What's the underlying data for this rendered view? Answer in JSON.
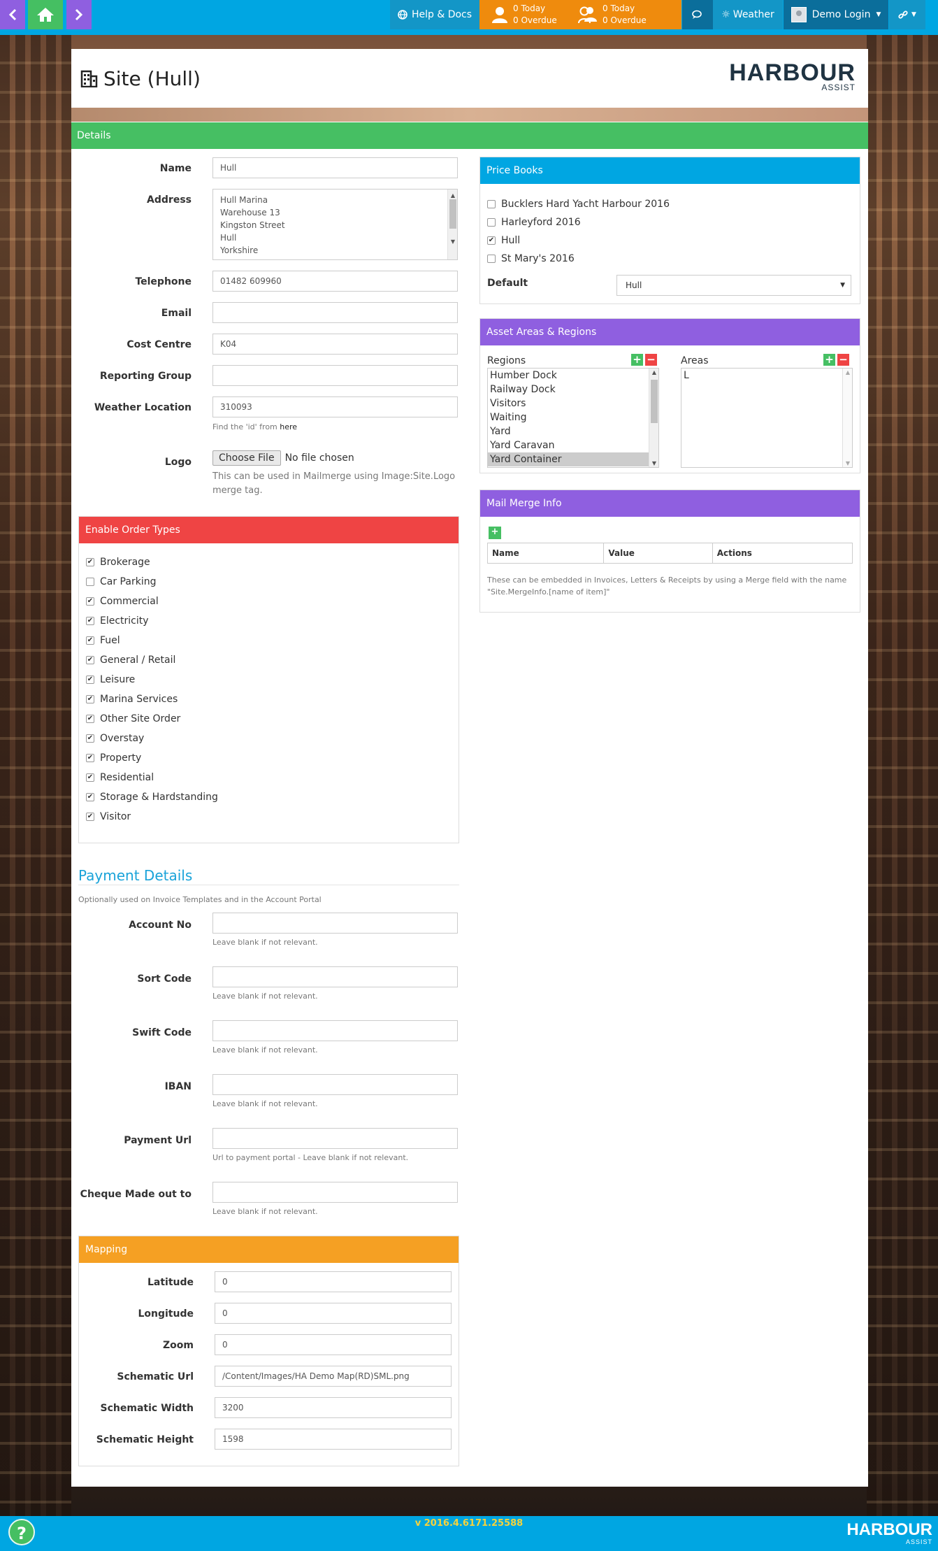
{
  "topbar": {
    "help_label": "Help & Docs",
    "tasks_assigned_today": "0 Today",
    "tasks_assigned_overdue": "0 Overdue",
    "tasks_team_today": "0 Today",
    "tasks_team_overdue": "0 Overdue",
    "weather_label": "Weather",
    "user_label": "Demo Login"
  },
  "page": {
    "title": "Site (Hull)",
    "logo_main": "HARBOUR",
    "logo_sub": "ASSIST",
    "details_header": "Details"
  },
  "details": {
    "name_label": "Name",
    "name_value": "Hull",
    "address_label": "Address",
    "address_lines": [
      "Hull Marina",
      "Warehouse 13",
      "Kingston Street",
      "Hull",
      "Yorkshire"
    ],
    "telephone_label": "Telephone",
    "telephone_value": "01482 609960",
    "email_label": "Email",
    "email_value": "",
    "cost_centre_label": "Cost Centre",
    "cost_centre_value": "K04",
    "reporting_group_label": "Reporting Group",
    "reporting_group_value": "",
    "weather_location_label": "Weather Location",
    "weather_location_value": "310093",
    "weather_help_prefix": "Find the 'id' from",
    "weather_help_link": "here",
    "logo_label": "Logo",
    "choose_file_label": "Choose File",
    "no_file_text": "No file chosen",
    "logo_help": "This can be used in Mailmerge using Image:Site.Logo merge tag."
  },
  "order_types": {
    "header": "Enable Order Types",
    "items": [
      {
        "label": "Brokerage",
        "checked": true
      },
      {
        "label": "Car Parking",
        "checked": false
      },
      {
        "label": "Commercial",
        "checked": true
      },
      {
        "label": "Electricity",
        "checked": true
      },
      {
        "label": "Fuel",
        "checked": true
      },
      {
        "label": "General / Retail",
        "checked": true
      },
      {
        "label": "Leisure",
        "checked": true
      },
      {
        "label": "Marina Services",
        "checked": true
      },
      {
        "label": "Other Site Order",
        "checked": true
      },
      {
        "label": "Overstay",
        "checked": true
      },
      {
        "label": "Property",
        "checked": true
      },
      {
        "label": "Residential",
        "checked": true
      },
      {
        "label": "Storage & Hardstanding",
        "checked": true
      },
      {
        "label": "Visitor",
        "checked": true
      }
    ]
  },
  "payment": {
    "heading": "Payment Details",
    "subtitle": "Optionally used on Invoice Templates and in the Account Portal",
    "account_no_label": "Account No",
    "sort_code_label": "Sort Code",
    "swift_code_label": "Swift Code",
    "iban_label": "IBAN",
    "payment_url_label": "Payment Url",
    "cheque_label": "Cheque Made out to",
    "blank_help": "Leave blank if not relevant.",
    "payment_url_help": "Url to payment portal - Leave blank if not relevant."
  },
  "mapping": {
    "header": "Mapping",
    "latitude_label": "Latitude",
    "latitude_value": "0",
    "longitude_label": "Longitude",
    "longitude_value": "0",
    "zoom_label": "Zoom",
    "zoom_value": "0",
    "schematic_url_label": "Schematic Url",
    "schematic_url_value": "/Content/Images/HA Demo Map(RD)SML.png",
    "schematic_width_label": "Schematic Width",
    "schematic_width_value": "3200",
    "schematic_height_label": "Schematic Height",
    "schematic_height_value": "1598"
  },
  "price_books": {
    "header": "Price Books",
    "items": [
      {
        "label": "Bucklers Hard Yacht Harbour 2016",
        "checked": false
      },
      {
        "label": "Harleyford 2016",
        "checked": false
      },
      {
        "label": "Hull",
        "checked": true
      },
      {
        "label": "St Mary's 2016",
        "checked": false
      }
    ],
    "default_label": "Default",
    "default_value": "Hull"
  },
  "asset_areas": {
    "header": "Asset Areas & Regions",
    "regions_label": "Regions",
    "regions": [
      "Humber Dock",
      "Railway Dock",
      "Visitors",
      "Waiting",
      "Yard",
      "Yard Caravan",
      "Yard Container"
    ],
    "selected_region": "Yard Container",
    "areas_label": "Areas",
    "areas": [
      "L"
    ]
  },
  "mail_merge": {
    "header": "Mail Merge Info",
    "columns": [
      "Name",
      "Value",
      "Actions"
    ],
    "help": "These can be embedded in Invoices, Letters & Receipts by using a Merge field with the name \"Site.MergeInfo.[name of item]\""
  },
  "footer": {
    "version": "v 2016.4.6171.25588",
    "logo_main": "HARBOUR",
    "logo_sub": "ASSIST"
  },
  "colors": {
    "topbar": "#00a6e2",
    "details": "#46bf63",
    "order_types": "#ef4444",
    "price_books": "#00a6e2",
    "asset_areas": "#8f5fe0",
    "mail_merge": "#8f5fe0",
    "mapping": "#f5a023"
  }
}
